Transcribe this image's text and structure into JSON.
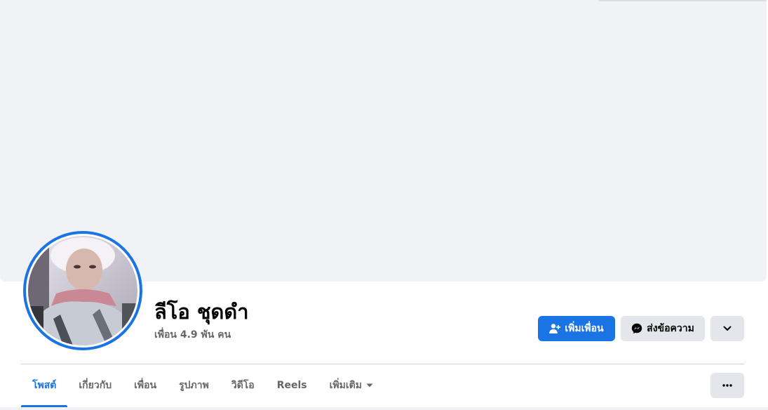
{
  "profile": {
    "name": "ลีโอ ชุดดำ",
    "friends_count": "เพื่อน 4.9 พัน คน"
  },
  "actions": {
    "add_friend_label": "เพิ่มเพื่อน",
    "message_label": "ส่งข้อความ"
  },
  "tabs": [
    {
      "label": "โพสต์",
      "active": true
    },
    {
      "label": "เกี่ยวกับ",
      "active": false
    },
    {
      "label": "เพื่อน",
      "active": false
    },
    {
      "label": "รูปภาพ",
      "active": false
    },
    {
      "label": "วิดีโอ",
      "active": false
    },
    {
      "label": "Reels",
      "active": false
    },
    {
      "label": "เพิ่มเติม",
      "active": false
    }
  ],
  "icons": {
    "add_friend": "person-plus-icon",
    "message": "messenger-icon",
    "more_actions": "chevron-down-icon",
    "tab_more": "caret-down-icon",
    "profile_menu": "more-dots-icon"
  },
  "colors": {
    "accent": "#1b74e4",
    "secondary_button": "#e4e6eb",
    "cover": "#f0f2f5",
    "muted_text": "#65676b"
  }
}
